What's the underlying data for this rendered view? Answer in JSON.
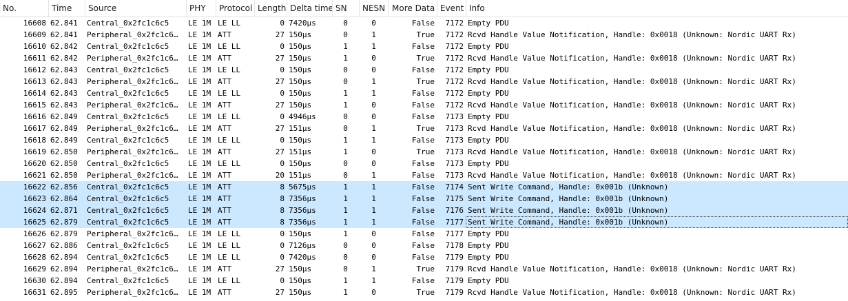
{
  "columns": {
    "no": "No.",
    "time": "Time",
    "source": "Source",
    "phy": "PHY",
    "protocol": "Protocol",
    "length": "Length",
    "delta": "Delta time",
    "sn": "SN",
    "nesn": "NESN",
    "more_data": "More Data",
    "event": "Event",
    "info": "Info"
  },
  "rows": [
    {
      "no": "16608",
      "time": "62.841",
      "source": "Central_0x2fc1c6c5",
      "phy": "LE 1M",
      "protocol": "LE LL",
      "length": "0",
      "delta": "7420µs",
      "sn": "0",
      "nesn": "0",
      "more_data": "False",
      "event": "7172",
      "info": "Empty PDU",
      "selected": false
    },
    {
      "no": "16609",
      "time": "62.841",
      "source": "Peripheral_0x2fc1c6…",
      "phy": "LE 1M",
      "protocol": "ATT",
      "length": "27",
      "delta": "150µs",
      "sn": "0",
      "nesn": "1",
      "more_data": "True",
      "event": "7172",
      "info": "Rcvd Handle Value Notification, Handle: 0x0018 (Unknown: Nordic UART Rx)",
      "selected": false
    },
    {
      "no": "16610",
      "time": "62.842",
      "source": "Central_0x2fc1c6c5",
      "phy": "LE 1M",
      "protocol": "LE LL",
      "length": "0",
      "delta": "150µs",
      "sn": "1",
      "nesn": "1",
      "more_data": "False",
      "event": "7172",
      "info": "Empty PDU",
      "selected": false
    },
    {
      "no": "16611",
      "time": "62.842",
      "source": "Peripheral_0x2fc1c6…",
      "phy": "LE 1M",
      "protocol": "ATT",
      "length": "27",
      "delta": "150µs",
      "sn": "1",
      "nesn": "0",
      "more_data": "True",
      "event": "7172",
      "info": "Rcvd Handle Value Notification, Handle: 0x0018 (Unknown: Nordic UART Rx)",
      "selected": false
    },
    {
      "no": "16612",
      "time": "62.843",
      "source": "Central_0x2fc1c6c5",
      "phy": "LE 1M",
      "protocol": "LE LL",
      "length": "0",
      "delta": "150µs",
      "sn": "0",
      "nesn": "0",
      "more_data": "False",
      "event": "7172",
      "info": "Empty PDU",
      "selected": false
    },
    {
      "no": "16613",
      "time": "62.843",
      "source": "Peripheral_0x2fc1c6…",
      "phy": "LE 1M",
      "protocol": "ATT",
      "length": "27",
      "delta": "150µs",
      "sn": "0",
      "nesn": "1",
      "more_data": "True",
      "event": "7172",
      "info": "Rcvd Handle Value Notification, Handle: 0x0018 (Unknown: Nordic UART Rx)",
      "selected": false
    },
    {
      "no": "16614",
      "time": "62.843",
      "source": "Central_0x2fc1c6c5",
      "phy": "LE 1M",
      "protocol": "LE LL",
      "length": "0",
      "delta": "150µs",
      "sn": "1",
      "nesn": "1",
      "more_data": "False",
      "event": "7172",
      "info": "Empty PDU",
      "selected": false
    },
    {
      "no": "16615",
      "time": "62.843",
      "source": "Peripheral_0x2fc1c6…",
      "phy": "LE 1M",
      "protocol": "ATT",
      "length": "27",
      "delta": "150µs",
      "sn": "1",
      "nesn": "0",
      "more_data": "False",
      "event": "7172",
      "info": "Rcvd Handle Value Notification, Handle: 0x0018 (Unknown: Nordic UART Rx)",
      "selected": false
    },
    {
      "no": "16616",
      "time": "62.849",
      "source": "Central_0x2fc1c6c5",
      "phy": "LE 1M",
      "protocol": "LE LL",
      "length": "0",
      "delta": "4946µs",
      "sn": "0",
      "nesn": "0",
      "more_data": "False",
      "event": "7173",
      "info": "Empty PDU",
      "selected": false
    },
    {
      "no": "16617",
      "time": "62.849",
      "source": "Peripheral_0x2fc1c6…",
      "phy": "LE 1M",
      "protocol": "ATT",
      "length": "27",
      "delta": "151µs",
      "sn": "0",
      "nesn": "1",
      "more_data": "True",
      "event": "7173",
      "info": "Rcvd Handle Value Notification, Handle: 0x0018 (Unknown: Nordic UART Rx)",
      "selected": false
    },
    {
      "no": "16618",
      "time": "62.849",
      "source": "Central_0x2fc1c6c5",
      "phy": "LE 1M",
      "protocol": "LE LL",
      "length": "0",
      "delta": "150µs",
      "sn": "1",
      "nesn": "1",
      "more_data": "False",
      "event": "7173",
      "info": "Empty PDU",
      "selected": false
    },
    {
      "no": "16619",
      "time": "62.850",
      "source": "Peripheral_0x2fc1c6…",
      "phy": "LE 1M",
      "protocol": "ATT",
      "length": "27",
      "delta": "151µs",
      "sn": "1",
      "nesn": "0",
      "more_data": "True",
      "event": "7173",
      "info": "Rcvd Handle Value Notification, Handle: 0x0018 (Unknown: Nordic UART Rx)",
      "selected": false
    },
    {
      "no": "16620",
      "time": "62.850",
      "source": "Central_0x2fc1c6c5",
      "phy": "LE 1M",
      "protocol": "LE LL",
      "length": "0",
      "delta": "150µs",
      "sn": "0",
      "nesn": "0",
      "more_data": "False",
      "event": "7173",
      "info": "Empty PDU",
      "selected": false
    },
    {
      "no": "16621",
      "time": "62.850",
      "source": "Peripheral_0x2fc1c6…",
      "phy": "LE 1M",
      "protocol": "ATT",
      "length": "20",
      "delta": "151µs",
      "sn": "0",
      "nesn": "1",
      "more_data": "False",
      "event": "7173",
      "info": "Rcvd Handle Value Notification, Handle: 0x0018 (Unknown: Nordic UART Rx)",
      "selected": false
    },
    {
      "no": "16622",
      "time": "62.856",
      "source": "Central_0x2fc1c6c5",
      "phy": "LE 1M",
      "protocol": "ATT",
      "length": "8",
      "delta": "5675µs",
      "sn": "1",
      "nesn": "1",
      "more_data": "False",
      "event": "7174",
      "info": "Sent Write Command, Handle: 0x001b (Unknown)",
      "selected": true
    },
    {
      "no": "16623",
      "time": "62.864",
      "source": "Central_0x2fc1c6c5",
      "phy": "LE 1M",
      "protocol": "ATT",
      "length": "8",
      "delta": "7356µs",
      "sn": "1",
      "nesn": "1",
      "more_data": "False",
      "event": "7175",
      "info": "Sent Write Command, Handle: 0x001b (Unknown)",
      "selected": true
    },
    {
      "no": "16624",
      "time": "62.871",
      "source": "Central_0x2fc1c6c5",
      "phy": "LE 1M",
      "protocol": "ATT",
      "length": "8",
      "delta": "7356µs",
      "sn": "1",
      "nesn": "1",
      "more_data": "False",
      "event": "7176",
      "info": "Sent Write Command, Handle: 0x001b (Unknown)",
      "selected": true
    },
    {
      "no": "16625",
      "time": "62.879",
      "source": "Central_0x2fc1c6c5",
      "phy": "LE 1M",
      "protocol": "ATT",
      "length": "8",
      "delta": "7356µs",
      "sn": "1",
      "nesn": "1",
      "more_data": "False",
      "event": "7177",
      "info": "Sent Write Command, Handle: 0x001b (Unknown)",
      "selected": true,
      "current": true
    },
    {
      "no": "16626",
      "time": "62.879",
      "source": "Peripheral_0x2fc1c6…",
      "phy": "LE 1M",
      "protocol": "LE LL",
      "length": "0",
      "delta": "150µs",
      "sn": "1",
      "nesn": "0",
      "more_data": "False",
      "event": "7177",
      "info": "Empty PDU",
      "selected": false
    },
    {
      "no": "16627",
      "time": "62.886",
      "source": "Central_0x2fc1c6c5",
      "phy": "LE 1M",
      "protocol": "LE LL",
      "length": "0",
      "delta": "7126µs",
      "sn": "0",
      "nesn": "0",
      "more_data": "False",
      "event": "7178",
      "info": "Empty PDU",
      "selected": false
    },
    {
      "no": "16628",
      "time": "62.894",
      "source": "Central_0x2fc1c6c5",
      "phy": "LE 1M",
      "protocol": "LE LL",
      "length": "0",
      "delta": "7420µs",
      "sn": "0",
      "nesn": "0",
      "more_data": "False",
      "event": "7179",
      "info": "Empty PDU",
      "selected": false
    },
    {
      "no": "16629",
      "time": "62.894",
      "source": "Peripheral_0x2fc1c6…",
      "phy": "LE 1M",
      "protocol": "ATT",
      "length": "27",
      "delta": "150µs",
      "sn": "0",
      "nesn": "1",
      "more_data": "True",
      "event": "7179",
      "info": "Rcvd Handle Value Notification, Handle: 0x0018 (Unknown: Nordic UART Rx)",
      "selected": false
    },
    {
      "no": "16630",
      "time": "62.894",
      "source": "Central_0x2fc1c6c5",
      "phy": "LE 1M",
      "protocol": "LE LL",
      "length": "0",
      "delta": "150µs",
      "sn": "1",
      "nesn": "1",
      "more_data": "False",
      "event": "7179",
      "info": "Empty PDU",
      "selected": false
    },
    {
      "no": "16631",
      "time": "62.895",
      "source": "Peripheral_0x2fc1c6…",
      "phy": "LE 1M",
      "protocol": "ATT",
      "length": "27",
      "delta": "150µs",
      "sn": "1",
      "nesn": "0",
      "more_data": "True",
      "event": "7179",
      "info": "Rcvd Handle Value Notification, Handle: 0x0018 (Unknown: Nordic UART Rx)",
      "selected": false
    }
  ],
  "colors": {
    "selected_row": "#cce8ff",
    "header_border": "#e1e1e1",
    "text": "#000000"
  }
}
